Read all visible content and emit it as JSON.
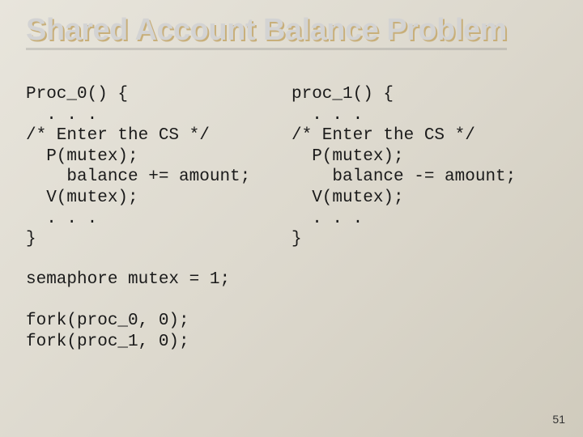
{
  "slide": {
    "title": "Shared Account Balance Problem",
    "left_code": "Proc_0() {\n  . . .\n/* Enter the CS */\n  P(mutex);\n    balance += amount;\n  V(mutex);\n  . . .\n}",
    "right_code": "proc_1() {\n  . . .\n/* Enter the CS */\n  P(mutex);\n    balance -= amount;\n  V(mutex);\n  . . .\n}",
    "extra_code": "semaphore mutex = 1;\n\nfork(proc_0, 0);\nfork(proc_1, 0);",
    "page_number": "51"
  }
}
